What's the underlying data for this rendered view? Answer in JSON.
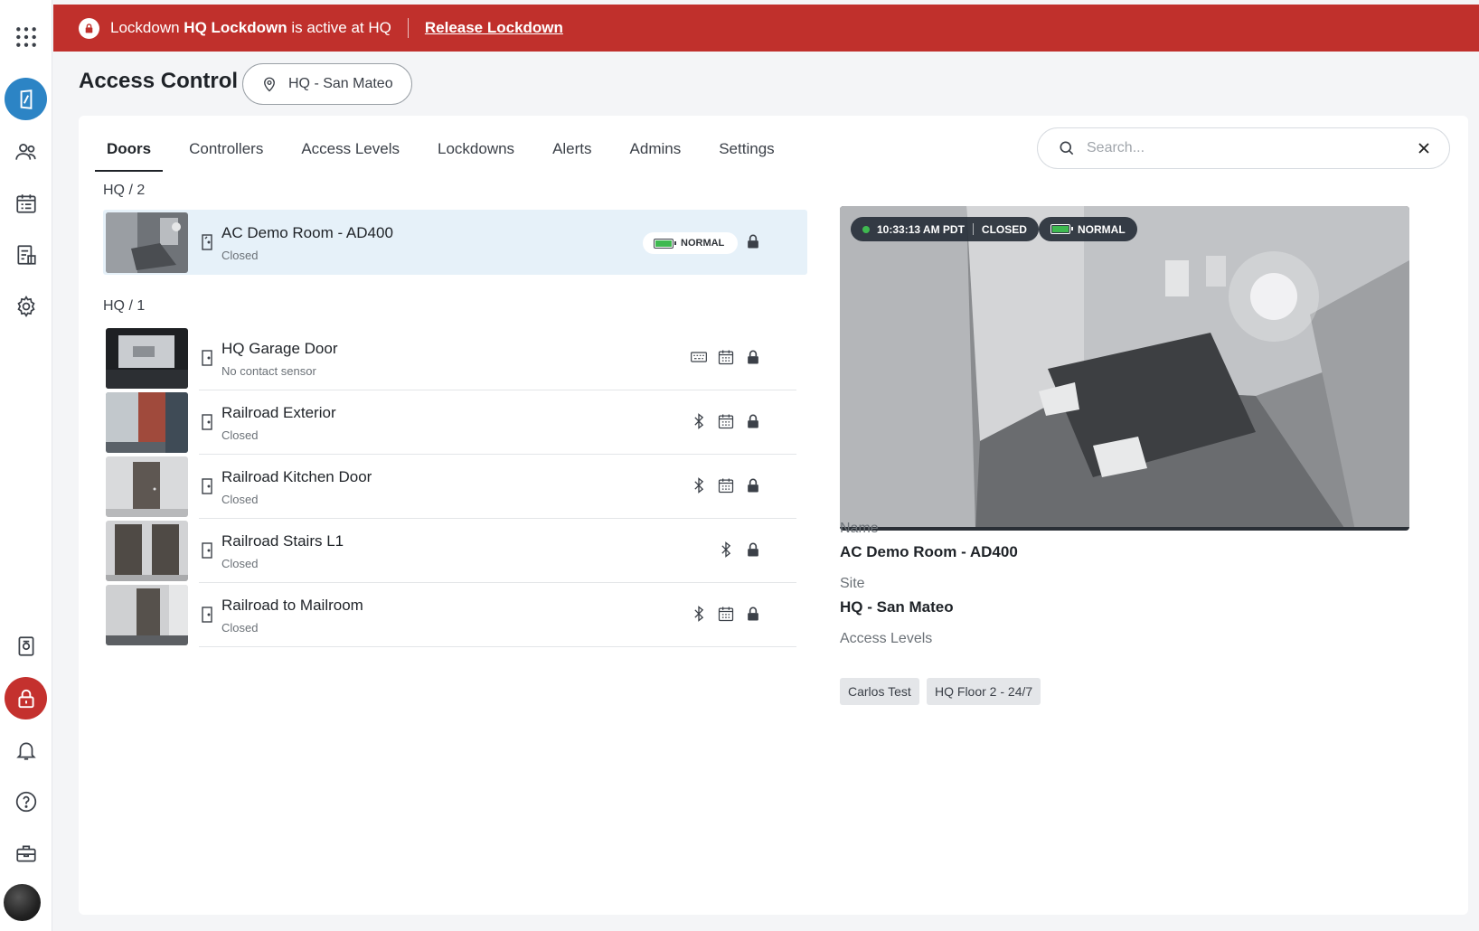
{
  "banner": {
    "prefix": "Lockdown",
    "lockdown_name": "HQ Lockdown",
    "suffix": "is active at HQ",
    "action": "Release Lockdown",
    "color": "#c0302c"
  },
  "rail": {
    "items": [
      "apps-grid-icon",
      "access-control-icon",
      "people-icon",
      "schedule-icon",
      "reports-icon",
      "settings-gear-icon",
      "device-icon",
      "lockdown-lock-icon",
      "bell-icon",
      "help-icon",
      "toolbox-icon",
      "avatar"
    ],
    "active_color": "#2c84c5",
    "lock_color": "#c4312e"
  },
  "header": {
    "title": "Access Control",
    "site": "HQ - San Mateo"
  },
  "tabs": [
    "Doors",
    "Controllers",
    "Access Levels",
    "Lockdowns",
    "Alerts",
    "Admins",
    "Settings"
  ],
  "active_tab": "Doors",
  "search": {
    "placeholder": "Search..."
  },
  "groups": [
    {
      "label": "HQ / 2",
      "doors": [
        {
          "name": "AC Demo Room - AD400",
          "status": "Closed",
          "badge": "NORMAL",
          "icons": [
            "battery-icon",
            "lock-icon"
          ]
        }
      ]
    },
    {
      "label": "HQ / 1",
      "doors": [
        {
          "name": "HQ Garage Door",
          "status": "No contact sensor",
          "icons": [
            "keypad-icon",
            "calendar-icon",
            "lock-icon"
          ]
        },
        {
          "name": "Railroad Exterior",
          "status": "Closed",
          "icons": [
            "bluetooth-icon",
            "calendar-icon",
            "lock-icon"
          ]
        },
        {
          "name": "Railroad Kitchen Door",
          "status": "Closed",
          "icons": [
            "bluetooth-icon",
            "calendar-icon",
            "lock-icon"
          ]
        },
        {
          "name": "Railroad Stairs L1",
          "status": "Closed",
          "icons": [
            "bluetooth-icon",
            "lock-icon"
          ]
        },
        {
          "name": "Railroad to Mailroom",
          "status": "Closed",
          "icons": [
            "bluetooth-icon",
            "calendar-icon",
            "lock-icon"
          ]
        }
      ]
    }
  ],
  "detail": {
    "camera_time": "10:33:13 AM PDT",
    "camera_state": "CLOSED",
    "camera_badge": "NORMAL",
    "name_label": "Name",
    "name": "AC Demo Room - AD400",
    "site_label": "Site",
    "site": "HQ - San Mateo",
    "levels_label": "Access Levels",
    "levels": [
      "Carlos Test",
      "HQ Floor 2 - 24/7"
    ]
  },
  "colors": {
    "selected_row": "#e6f1f9",
    "battery_ok": "#3fb950"
  }
}
